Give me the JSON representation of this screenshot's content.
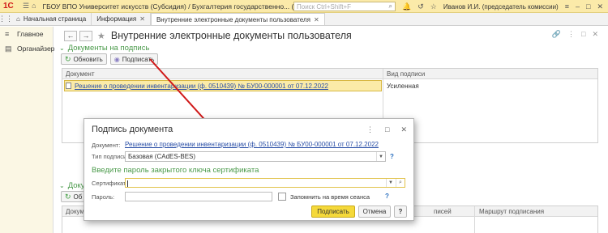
{
  "titlebar": {
    "logo": "1С",
    "title": "ГБОУ ВПО Университет искусств (Субсидия) / Бухгалтерия государственно... (1С:Предприятие)",
    "search_placeholder": "Поиск Ctrl+Shift+F",
    "user": "Иванов И.И. (председатель комиссии)"
  },
  "tabs": [
    {
      "label": "Начальная страница"
    },
    {
      "label": "Информация"
    },
    {
      "label": "Внутренние электронные документы пользователя"
    }
  ],
  "sidebar": {
    "items": [
      {
        "label": "Главное",
        "icon": "menu-icon"
      },
      {
        "label": "Органайзер",
        "icon": "organizer-icon"
      }
    ]
  },
  "form": {
    "title": "Внутренние электронные документы пользователя",
    "group_to_sign": "Документы на подпись",
    "refresh_label": "Обновить",
    "sign_label": "Подписать",
    "columns": [
      "Документ",
      "Вид подписи"
    ],
    "rows": [
      {
        "document": "Решение о проведении инвентаризации (ф. 0510439) № БУ00-000001 от 07.12.2022",
        "signature_type": "Усиленная"
      }
    ],
    "group2_title": "Докум",
    "group2_button": "Об",
    "grid2_columns": [
      "Докум",
      "писей",
      "Маршрут подписания"
    ]
  },
  "modal": {
    "title": "Подпись документа",
    "doc_label": "Документ:",
    "doc_value": "Решение о проведении инвентаризации (ф. 0510439) № БУ00-000001 от 07.12.2022",
    "sign_type_label": "Тип подписи:",
    "sign_type_value": "Базовая (CAdES-BES)",
    "section_title": "Введите пароль закрытого ключа сертификата",
    "cert_label": "Сертификат:",
    "cert_value": "",
    "password_label": "Пароль:",
    "password_value": "",
    "remember_label": "Запомнить на время сеанса",
    "remember_checked": false,
    "sign_button": "Подписать",
    "cancel_button": "Отмена",
    "help_button": "?",
    "help_q": "?"
  },
  "colors": {
    "accent_yellow": "#f5d93a",
    "group_green": "#4a9a4a",
    "link_blue": "#2a4fa7",
    "arrow_red": "#d01818"
  }
}
